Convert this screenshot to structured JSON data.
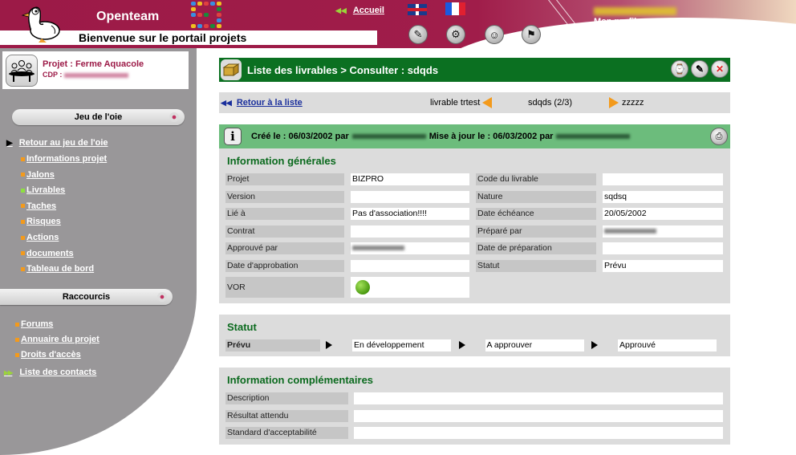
{
  "header": {
    "brand": "Openteam",
    "tagline": "Bienvenue sur le portail projets",
    "home_link": "Accueil",
    "languages": [
      {
        "name": "uk-flag-icon",
        "label": "English"
      },
      {
        "name": "fr-flag-icon",
        "label": "Français"
      }
    ],
    "tool_icons": [
      "tools-icon",
      "gear-icon",
      "user-icon",
      "runner-icon"
    ],
    "user_name": "[blurred]",
    "profile_link": "Mon profil",
    "colors": {
      "brand": "#9c1a47",
      "accent_green": "#9bd43a"
    }
  },
  "sidebar": {
    "project_title": "Projet : Ferme Aquacole",
    "cdp_label": "CDP :",
    "cdp_value": "[blurred]",
    "section1_title": "Jeu de l'oie",
    "back_link": "Retour au jeu de l'oie",
    "items": [
      {
        "label": "Informations projet",
        "status": "orange"
      },
      {
        "label": "Jalons",
        "status": "orange"
      },
      {
        "label": "Livrables",
        "status": "green"
      },
      {
        "label": "Taches",
        "status": "orange"
      },
      {
        "label": "Risques",
        "status": "orange"
      },
      {
        "label": "Actions",
        "status": "orange"
      },
      {
        "label": "documents",
        "status": "orange"
      },
      {
        "label": "Tableau de bord",
        "status": "orange"
      }
    ],
    "section2_title": "Raccourcis",
    "shortcuts": [
      {
        "label": "Forums"
      },
      {
        "label": "Annuaire du projet"
      },
      {
        "label": "Droits d'accès"
      }
    ],
    "contacts_link": "Liste des contacts"
  },
  "main": {
    "title": "Liste des livrables > Consulter : sdqds",
    "title_buttons": [
      "history-icon",
      "edit-icon",
      "close-icon"
    ],
    "nav": {
      "back": "Retour à la liste",
      "prev": "livrable trtest",
      "current": "sdqds (2/3)",
      "next": "zzzzz"
    },
    "info": {
      "created_label": "Créé le :",
      "created_date": "06/03/2002",
      "by": "par",
      "created_by": "[blurred]",
      "updated_label": "Mise à jour le :",
      "updated_date": "06/03/2002",
      "updated_by": "[blurred]"
    },
    "general": {
      "title": "Information générales",
      "left": [
        {
          "label": "Projet",
          "value": "BIZPRO"
        },
        {
          "label": "Version",
          "value": ""
        },
        {
          "label": "Lié à",
          "value": "Pas d'association!!!!"
        },
        {
          "label": "Contrat",
          "value": ""
        },
        {
          "label": "Approuvé par",
          "value": "[blurred]"
        },
        {
          "label": "Date d'approbation",
          "value": ""
        },
        {
          "label": "VOR",
          "value": "green"
        }
      ],
      "right": [
        {
          "label": "Code du livrable",
          "value": ""
        },
        {
          "label": "Nature",
          "value": "sqdsq"
        },
        {
          "label": "Date échéance",
          "value": "20/05/2002"
        },
        {
          "label": "Préparé par",
          "value": "[blurred]"
        },
        {
          "label": "Date de préparation",
          "value": ""
        },
        {
          "label": "Statut",
          "value": "Prévu"
        }
      ]
    },
    "status": {
      "title": "Statut",
      "steps": [
        "Prévu",
        "En développement",
        "A approuver",
        "Approuvé"
      ],
      "current": "Prévu"
    },
    "complementary": {
      "title": "Information complémentaires",
      "rows": [
        {
          "label": "Description",
          "value": ""
        },
        {
          "label": "Résultat attendu",
          "value": ""
        },
        {
          "label": "Standard d'acceptabilité",
          "value": ""
        }
      ]
    }
  }
}
